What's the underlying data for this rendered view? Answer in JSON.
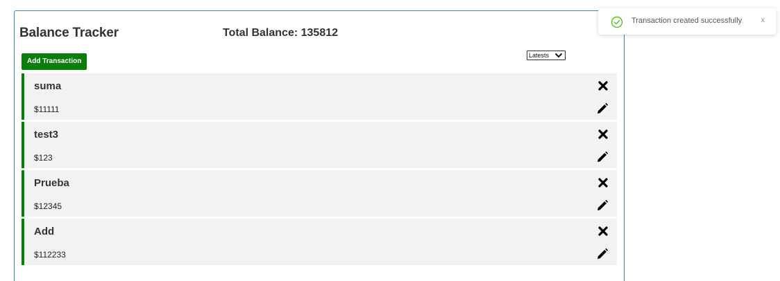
{
  "app": {
    "title": "Balance Tracker",
    "total_balance_label": "Total Balance: 135812"
  },
  "toolbar": {
    "add_label": "Add Transaction",
    "sort_selected": "Latests"
  },
  "transactions": [
    {
      "name": "suma",
      "amount": "$11111"
    },
    {
      "name": "test3",
      "amount": "$123"
    },
    {
      "name": "Prueba",
      "amount": "$12345"
    },
    {
      "name": "Add",
      "amount": "$112233"
    }
  ],
  "toast": {
    "message": "Transaction created successfully",
    "close_label": "x",
    "icon": "check-circle-icon"
  },
  "colors": {
    "accent_green": "#0b7d0b",
    "panel_border": "#3a82b8",
    "item_bg": "#f2f2f2",
    "success": "#52c41a"
  }
}
